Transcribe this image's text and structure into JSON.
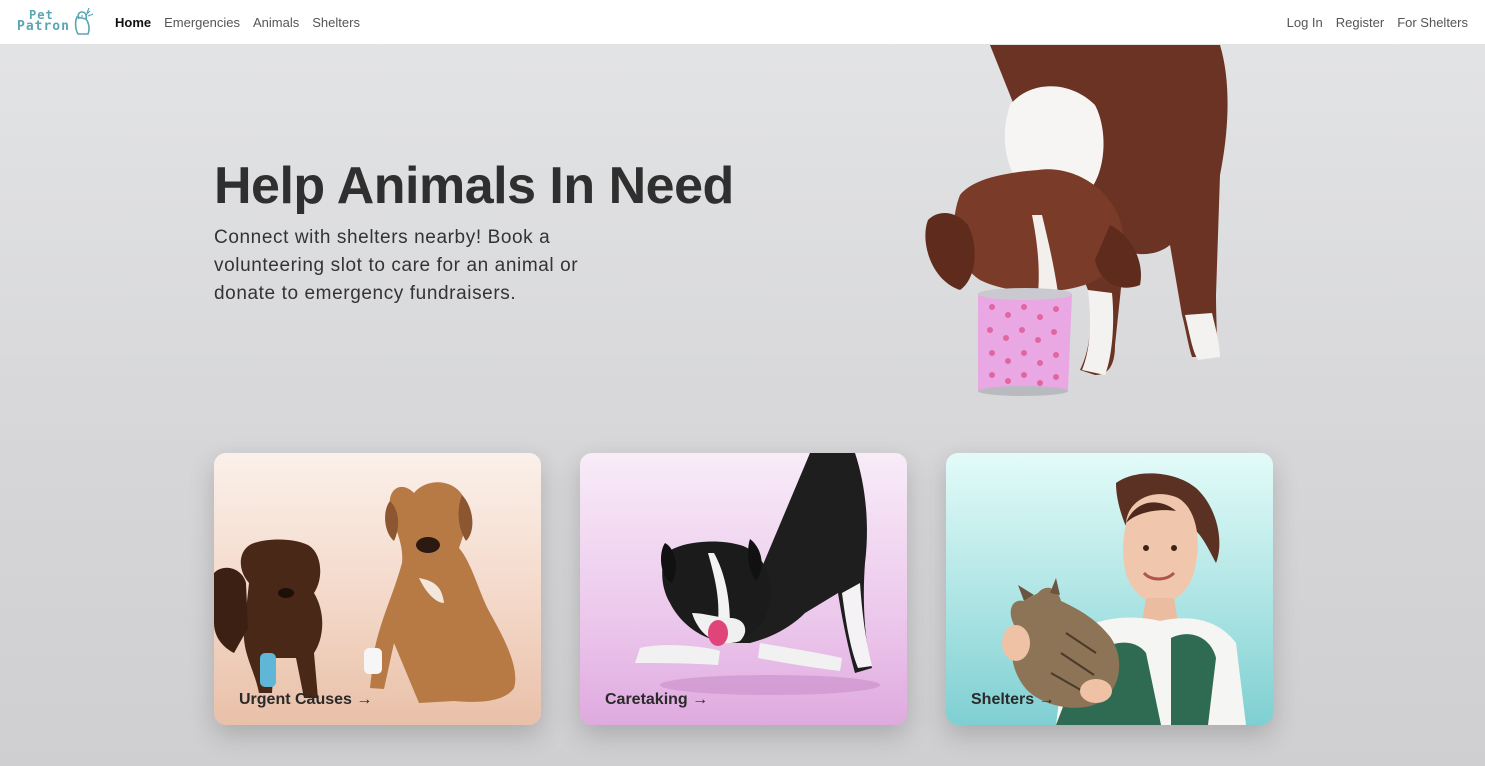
{
  "brand": {
    "line1": "Pet",
    "line2": "Patron",
    "logo_icon": "dog-logo-icon"
  },
  "nav": {
    "left": [
      {
        "label": "Home",
        "active": true
      },
      {
        "label": "Emergencies",
        "active": false
      },
      {
        "label": "Animals",
        "active": false
      },
      {
        "label": "Shelters",
        "active": false
      }
    ],
    "right": [
      {
        "label": "Log In"
      },
      {
        "label": "Register"
      },
      {
        "label": "For Shelters"
      }
    ]
  },
  "hero": {
    "title": "Help Animals In Need",
    "subtitle": "Connect with shelters nearby! Book a volunteering slot to care for an animal or donate to emergency fundraisers.",
    "image": "dog-eating-from-can"
  },
  "cards": [
    {
      "label": "Urgent Causes →",
      "image": "injured-dogs"
    },
    {
      "label": "Caretaking →",
      "image": "playful-border-collie"
    },
    {
      "label": "Shelters →",
      "image": "woman-holding-kitten"
    }
  ],
  "colors": {
    "accent": "#5aa6b3",
    "card_urgent": "#f3d8c8",
    "card_caretaking": "#ecc8ec",
    "card_shelters": "#a8e2e2"
  }
}
